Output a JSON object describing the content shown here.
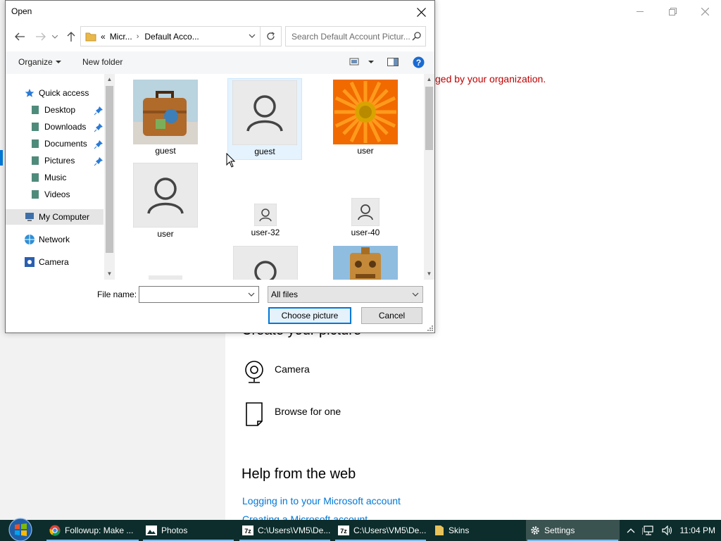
{
  "dialog": {
    "title": "Open",
    "address": {
      "crumb_prefix": "«",
      "crumb1": "Micr...",
      "crumb2": "Default Acco..."
    },
    "search_placeholder": "Search Default Account Pictur...",
    "toolbar": {
      "organize": "Organize",
      "new_folder": "New folder"
    },
    "nav": {
      "quick_access": "Quick access",
      "desktop": "Desktop",
      "downloads": "Downloads",
      "documents": "Documents",
      "pictures": "Pictures",
      "music": "Music",
      "videos": "Videos",
      "my_computer": "My Computer",
      "network": "Network",
      "camera": "Camera"
    },
    "files": [
      {
        "name": "guest",
        "thumb": "suitcase"
      },
      {
        "name": "guest",
        "thumb": "user-silhouette",
        "selected": true
      },
      {
        "name": "user",
        "thumb": "orange-flower"
      },
      {
        "name": "user",
        "thumb": "user-silhouette"
      },
      {
        "name": "user-32",
        "thumb": "user-silhouette-small"
      },
      {
        "name": "user-40",
        "thumb": "user-silhouette-small"
      }
    ],
    "file_name_label": "File name:",
    "file_name_value": "",
    "file_type": "All files",
    "choose_button": "Choose picture",
    "cancel_button": "Cancel"
  },
  "settings": {
    "org_message": "ged by your organization.",
    "create_heading": "Create your picture",
    "camera_option": "Camera",
    "browse_option": "Browse for one",
    "help_heading": "Help from the web",
    "help_link1": "Logging in to your Microsoft account",
    "help_link2": "Creating a Microsoft account"
  },
  "taskbar": {
    "items": [
      {
        "label": "Followup: Make ...",
        "icon": "chrome-icon"
      },
      {
        "label": "Photos",
        "icon": "photos-icon"
      },
      {
        "label": "C:\\Users\\VM5\\De...",
        "icon": "7zip-icon"
      },
      {
        "label": "C:\\Users\\VM5\\De...",
        "icon": "7zip-icon"
      },
      {
        "label": "Skins",
        "icon": "folder-icon"
      },
      {
        "label": "Settings",
        "icon": "gear-icon"
      }
    ],
    "clock": "11:04 PM"
  },
  "colors": {
    "accent": "#0078d7",
    "org_message": "#c00000",
    "taskbar": "#0c2d2c"
  }
}
